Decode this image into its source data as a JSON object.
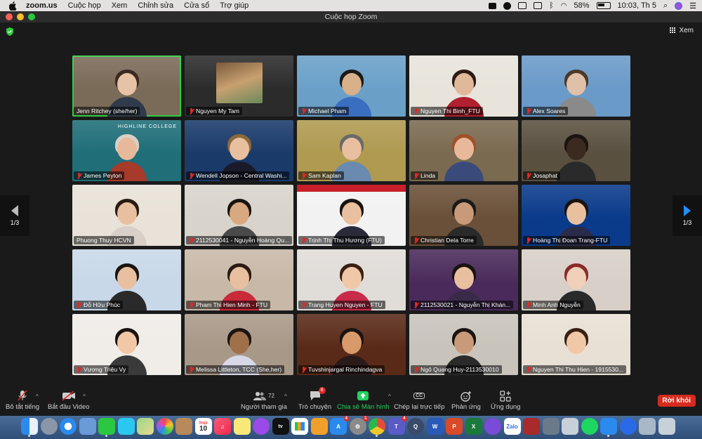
{
  "menubar": {
    "app_name": "zoom.us",
    "items": [
      "Cuộc họp",
      "Xem",
      "Chỉnh sửa",
      "Cửa sổ",
      "Trợ giúp"
    ],
    "battery": "58%",
    "clock": "10:03, Th 5"
  },
  "window": {
    "title": "Cuộc họp Zoom"
  },
  "view_button": {
    "label": "Xem"
  },
  "pagination": {
    "left": "1/3",
    "right": "1/3"
  },
  "participants": [
    {
      "name": "Jenn Ritchey (she/her)",
      "muted": false,
      "active": true,
      "bg": "#7a6a58",
      "skin": "#e6c2a6",
      "hair": "#3a2a20",
      "shirt": "#2f3a4a"
    },
    {
      "name": "Nguyen My Tam",
      "muted": true,
      "active": false,
      "bg": "#2b2b2b",
      "skin": "#c9a27a",
      "hair": "#7a5a3a",
      "shirt": "#8a6a4a",
      "photo": true
    },
    {
      "name": "Michael Pham",
      "muted": true,
      "active": false,
      "bg": "#6aa0c8",
      "skin": "#d8b08a",
      "hair": "#1a1a1a",
      "shirt": "#3a6ec0"
    },
    {
      "name": "Nguyen Thi Binh_FTU",
      "muted": true,
      "active": false,
      "bg": "#e8e4dc",
      "skin": "#e0b89a",
      "hair": "#2a1a12",
      "shirt": "#b02030"
    },
    {
      "name": "Alex Soares",
      "muted": true,
      "active": false,
      "bg": "#6a9ac8",
      "skin": "#e0c0a8",
      "hair": "#4a3a2a",
      "shirt": "#8a8a8a"
    },
    {
      "name": "James Peyton",
      "muted": true,
      "active": false,
      "bg": "#1f6e78",
      "skin": "#e8b89a",
      "hair": "#d8d0c8",
      "shirt": "#a83a2a",
      "logo": "HIGHLINE COLLEGE"
    },
    {
      "name": "Wendell Jopson - Central Washi...",
      "muted": true,
      "active": false,
      "bg": "#1a3a6a",
      "skin": "#e8c0a0",
      "hair": "#8a6a3a",
      "shirt": "#1a1a2a"
    },
    {
      "name": "Sam Kaplan",
      "muted": true,
      "active": false,
      "bg": "#b09a50",
      "skin": "#e8c0a0",
      "hair": "#6a6a6a",
      "shirt": "#6a8ab0"
    },
    {
      "name": "Linda",
      "muted": true,
      "active": false,
      "bg": "#7a6a50",
      "skin": "#e8b89a",
      "hair": "#a0502a",
      "shirt": "#3a4a7a"
    },
    {
      "name": "Josaphat",
      "muted": true,
      "active": false,
      "bg": "#5a5040",
      "skin": "#3a2a20",
      "hair": "#1a1410",
      "shirt": "#2a2a2a"
    },
    {
      "name": "Phuong Thuy HCVN",
      "muted": false,
      "active": false,
      "bg": "#e8e2d8",
      "skin": "#e8c0a0",
      "hair": "#2a1a12",
      "shirt": "#d8d0c8"
    },
    {
      "name": "2112530041 - Nguyễn Hoàng Qu...",
      "muted": true,
      "active": false,
      "bg": "#d8d4cc",
      "skin": "#d8a880",
      "hair": "#1a1410",
      "shirt": "#4a4a4a"
    },
    {
      "name": "Trịnh Thị Thu Hương (FTU)",
      "muted": true,
      "active": false,
      "bg": "#f2f2f2",
      "skin": "#e8c0a0",
      "hair": "#1a1410",
      "shirt": "#2a2a3a",
      "banner": true
    },
    {
      "name": "Christian Dela Torre",
      "muted": true,
      "active": false,
      "bg": "#6a5038",
      "skin": "#c89a7a",
      "hair": "#1a1a1a",
      "shirt": "#2a2a2a"
    },
    {
      "name": "Hoàng Thị Đoan Trang-FTU",
      "muted": true,
      "active": false,
      "bg": "#0a3a8a",
      "skin": "#e8c0a0",
      "hair": "#1a1410",
      "shirt": "#2a2a4a"
    },
    {
      "name": "Đỗ Hữu Phúc",
      "muted": true,
      "active": false,
      "bg": "#c8d8e8",
      "skin": "#e8c0a0",
      "hair": "#1a1410",
      "shirt": "#2a2a2a"
    },
    {
      "name": "Pham Thi Hien Minh - FTU",
      "muted": true,
      "active": false,
      "bg": "#c8b8a8",
      "skin": "#e8c0a0",
      "hair": "#2a1a12",
      "shirt": "#c82a3a"
    },
    {
      "name": "Trang Huyen Nguyen - FTU",
      "muted": true,
      "active": false,
      "bg": "#e0dcd8",
      "skin": "#f0c8a8",
      "hair": "#3a2012",
      "shirt": "#c82a4a"
    },
    {
      "name": "2112530021 - Nguyễn Thị Khán...",
      "muted": true,
      "active": false,
      "bg": "#4a2a5a",
      "skin": "#e8c0a0",
      "hair": "#1a1410",
      "shirt": "#3a2a4a"
    },
    {
      "name": "Minh Anh Nguyễn",
      "muted": true,
      "active": false,
      "bg": "#d8d0c8",
      "skin": "#f0d0b8",
      "hair": "#8a2a2a",
      "shirt": "#2a2a2a"
    },
    {
      "name": "Vương Triệu Vy",
      "muted": true,
      "active": false,
      "bg": "#f0ece8",
      "skin": "#f0c8a8",
      "hair": "#1a1410",
      "shirt": "#3a3a3a"
    },
    {
      "name": "Melissa Littleton, TCC (She,her)",
      "muted": true,
      "active": false,
      "bg": "#a89888",
      "skin": "#a0704a",
      "hair": "#1a1410",
      "shirt": "#d8d8e8"
    },
    {
      "name": "Tuvshinjargal Rinchindagva",
      "muted": true,
      "active": false,
      "bg": "#5a2a18",
      "skin": "#d89a6a",
      "hair": "#1a1410",
      "shirt": "#2a1a1a"
    },
    {
      "name": "Ngô Quang Huy-2113530010",
      "muted": true,
      "active": false,
      "bg": "#c8c4bc",
      "skin": "#c89a7a",
      "hair": "#1a1410",
      "shirt": "#2a2a2a"
    },
    {
      "name": "Nguyen Thi Thu Hien - 1915530...",
      "muted": true,
      "active": false,
      "bg": "#e8e0d4",
      "skin": "#f0c8a8",
      "hair": "#3a2012",
      "shirt": "#e8e0d8"
    }
  ],
  "toolbar": {
    "mute_all": "Bỏ tắt tiếng",
    "start_video": "Bắt đầu Video",
    "participants": "Người tham gia",
    "participants_count": "72",
    "chat": "Trò chuyện",
    "chat_badge": "8",
    "share": "Chia sẻ Màn hình",
    "captions": "Chép lại trực tiếp",
    "captions_icon_text": "CC",
    "reactions": "Phản ứng",
    "apps": "Ứng dụng",
    "leave": "Rời khỏi"
  },
  "dock": {
    "calendar_day": "10",
    "calendar_month": "TH10",
    "zalo": "Zalo",
    "appstore_badge": "4",
    "settings_badge": "1",
    "teams_badge": "4"
  },
  "colors": {
    "share_green": "#23d160",
    "leave_red": "#d52b1e",
    "active_speaker": "#2ecc40"
  }
}
